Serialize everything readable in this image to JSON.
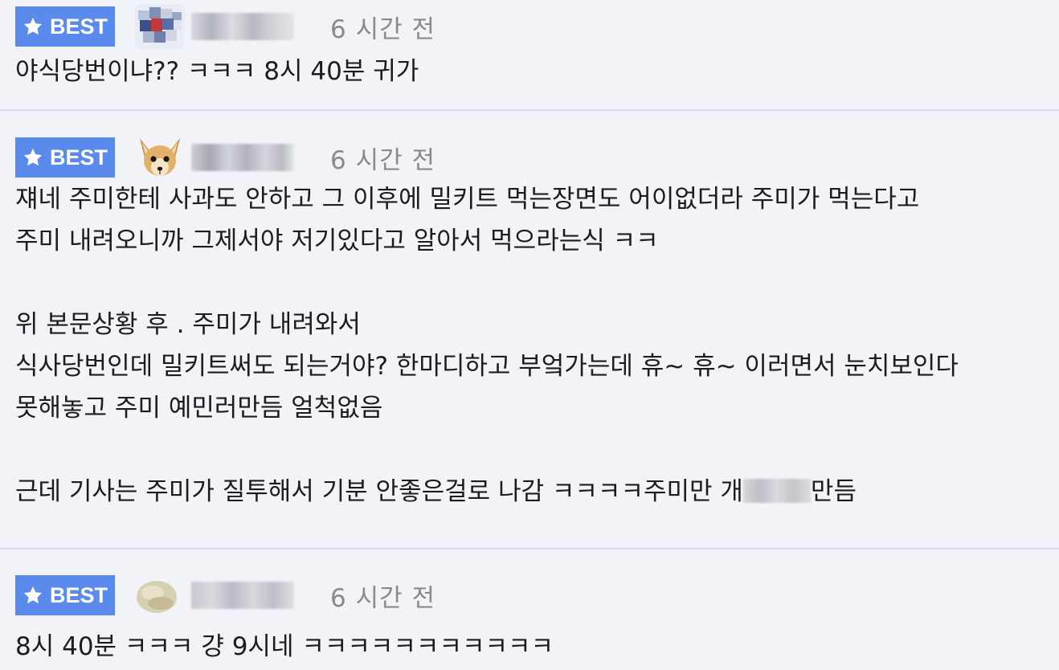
{
  "colors": {
    "page_background": "#f2f3f8",
    "best_badge": "#5a8bec",
    "divider": "#d9dbe4",
    "timestamp": "#8a8a8a"
  },
  "comments": [
    {
      "badge_label": "BEST",
      "badge_icon": "star-icon",
      "avatar": "pixelated-avatar",
      "timestamp": "6 시간 전",
      "lines": [
        "야식당번이냐?? ㅋㅋㅋ 8시 40분 귀가"
      ]
    },
    {
      "badge_label": "BEST",
      "badge_icon": "star-icon",
      "avatar": "dog-face-avatar",
      "timestamp": "6 시간 전",
      "lines": [
        "쟤네 주미한테 사과도 안하고 그 이후에 밀키트 먹는장면도 어이없더라 주미가 먹는다고 ",
        "주미 내려오니까 그제서야 저기있다고 알아서 먹으라는식 ㅋㅋ",
        "",
        "위 본문상황 후 . 주미가 내려와서",
        "식사당번인데 밀키트써도 되는거야? 한마디하고 부엌가는데 휴~ 휴~ 이러면서 눈치보인다",
        "못해놓고 주미 예민러만듬 얼척없음",
        "",
        "근데 기사는 주미가 질투해서 기분 안좋은걸로 나감 ㅋㅋㅋㅋ주미만 개",
        "만듬"
      ]
    },
    {
      "badge_label": "BEST",
      "badge_icon": "star-icon",
      "avatar": "round-beige-avatar",
      "timestamp": "6 시간 전",
      "lines": [
        "8시 40분 ㅋㅋㅋ 걍 9시네 ㅋㅋㅋㅋㅋㅋㅋㅋㅋㅋㅋ"
      ]
    }
  ]
}
